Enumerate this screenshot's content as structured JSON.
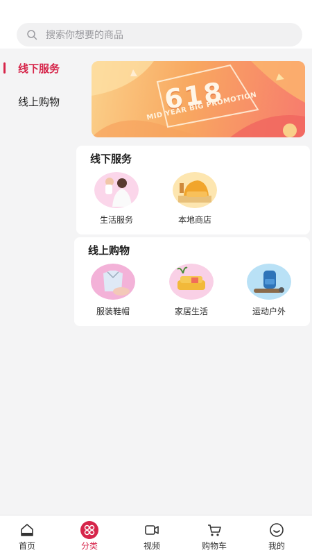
{
  "search": {
    "placeholder": "搜索你想要的商品"
  },
  "sidebar": {
    "items": [
      {
        "label": "线下服务",
        "active": true
      },
      {
        "label": "线上购物",
        "active": false
      }
    ]
  },
  "banner": {
    "number": "618",
    "subtitle": "MID YEAR BIG PROMOTION"
  },
  "sections": [
    {
      "title": "线下服务",
      "tiles": [
        {
          "label": "生活服务",
          "icon": "massage-image"
        },
        {
          "label": "本地商店",
          "icon": "armchair-image"
        }
      ]
    },
    {
      "title": "线上购物",
      "tiles": [
        {
          "label": "服装鞋帽",
          "icon": "clothing-image"
        },
        {
          "label": "家居生活",
          "icon": "sofa-image"
        },
        {
          "label": "运动户外",
          "icon": "backpack-image"
        }
      ]
    }
  ],
  "bottom_nav": [
    {
      "label": "首页",
      "icon": "home-icon"
    },
    {
      "label": "分类",
      "icon": "category-icon",
      "active": true
    },
    {
      "label": "视频",
      "icon": "video-icon"
    },
    {
      "label": "购物车",
      "icon": "cart-icon"
    },
    {
      "label": "我的",
      "icon": "profile-icon"
    }
  ],
  "colors": {
    "accent": "#d6254a",
    "background": "#f4f4f5"
  }
}
